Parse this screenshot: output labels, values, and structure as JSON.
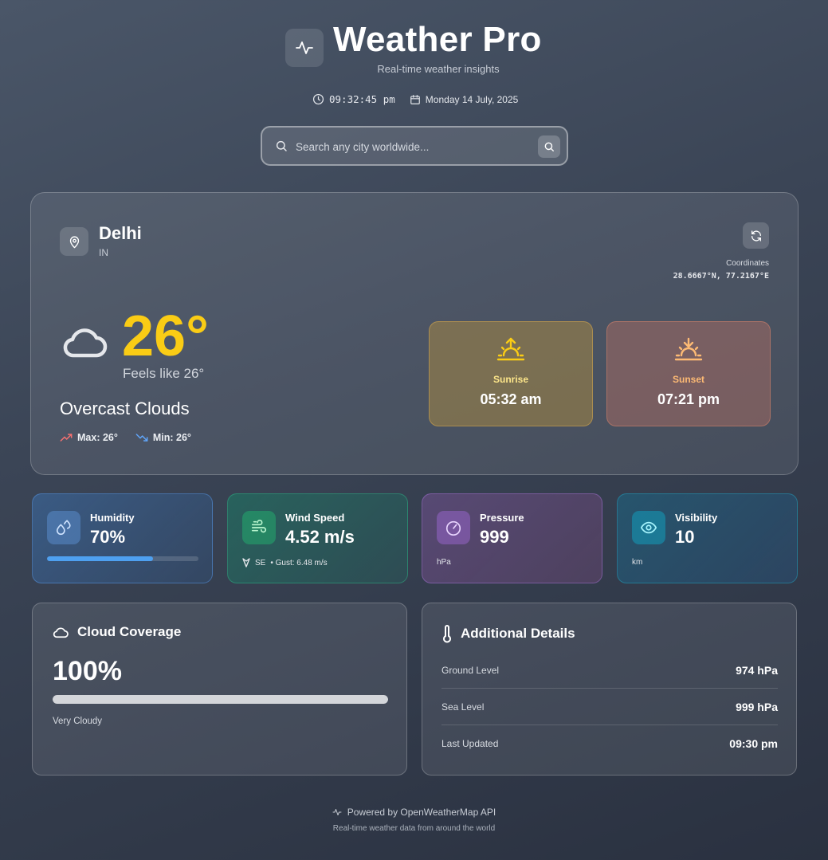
{
  "header": {
    "title": "Weather Pro",
    "subtitle": "Real-time weather insights",
    "logo_icon": "activity-icon",
    "time": "09:32:45 pm",
    "date": "Monday 14 July, 2025"
  },
  "search": {
    "placeholder": "Search any city worldwide...",
    "value": ""
  },
  "location": {
    "city": "Delhi",
    "country": "IN",
    "coordinates_label": "Coordinates",
    "coordinates": "28.6667°N, 77.2167°E"
  },
  "current": {
    "temperature": "26°",
    "feels_like": "Feels like 26°",
    "condition": "Overcast Clouds",
    "max": "Max: 26°",
    "min": "Min: 26°",
    "icon": "cloud-icon"
  },
  "sun": {
    "sunrise_label": "Sunrise",
    "sunrise": "05:32 am",
    "sunset_label": "Sunset",
    "sunset": "07:21 pm"
  },
  "stats": {
    "humidity": {
      "label": "Humidity",
      "value": "70%",
      "percent": 70
    },
    "wind": {
      "label": "Wind Speed",
      "value": "4.52 m/s",
      "direction": "SE",
      "gust": "• Gust: 6.48 m/s"
    },
    "pressure": {
      "label": "Pressure",
      "value": "999",
      "unit": "hPa"
    },
    "visibility": {
      "label": "Visibility",
      "value": "10",
      "unit": "km"
    }
  },
  "cloud_coverage": {
    "title": "Cloud Coverage",
    "value": "100%",
    "percent": 100,
    "description": "Very Cloudy"
  },
  "details": {
    "title": "Additional Details",
    "rows": [
      {
        "label": "Ground Level",
        "value": "974 hPa"
      },
      {
        "label": "Sea Level",
        "value": "999 hPa"
      },
      {
        "label": "Last Updated",
        "value": "09:30 pm"
      }
    ]
  },
  "footer": {
    "powered": "Powered by OpenWeatherMap API",
    "tagline": "Real-time weather data from around the world"
  },
  "colors": {
    "temperature": "#facc15",
    "humidity_bar": "#4ea0f0",
    "max_arrow": "#f87171",
    "min_arrow": "#60a5fa"
  }
}
